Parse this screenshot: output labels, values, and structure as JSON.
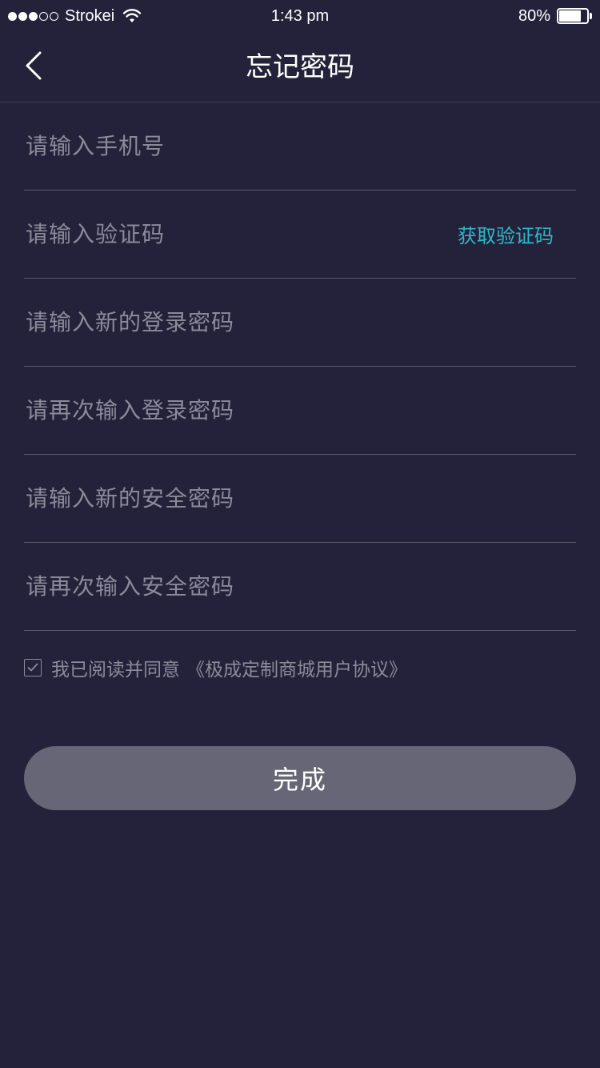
{
  "status_bar": {
    "carrier": "Strokei",
    "time": "1:43 pm",
    "battery_percent_label": "80%",
    "battery_level": 0.8,
    "signal_dots_filled": 3,
    "signal_dots_total": 5
  },
  "nav": {
    "title": "忘记密码",
    "back_icon": "chevron-left-icon"
  },
  "form": {
    "phone_placeholder": "请输入手机号",
    "code_placeholder": "请输入验证码",
    "get_code_label": "获取验证码",
    "new_login_password_placeholder": "请输入新的登录密码",
    "confirm_login_password_placeholder": "请再次输入登录密码",
    "new_security_password_placeholder": "请输入新的安全密码",
    "confirm_security_password_placeholder": "请再次输入安全密码"
  },
  "agreement": {
    "checked": true,
    "text": "我已阅读并同意",
    "link_text": "《极成定制商城用户协议》"
  },
  "submit": {
    "label": "完成"
  },
  "colors": {
    "background": "#23223a",
    "accent": "#2eb8c9",
    "placeholder": "#8b8a99",
    "button": "#676676"
  }
}
